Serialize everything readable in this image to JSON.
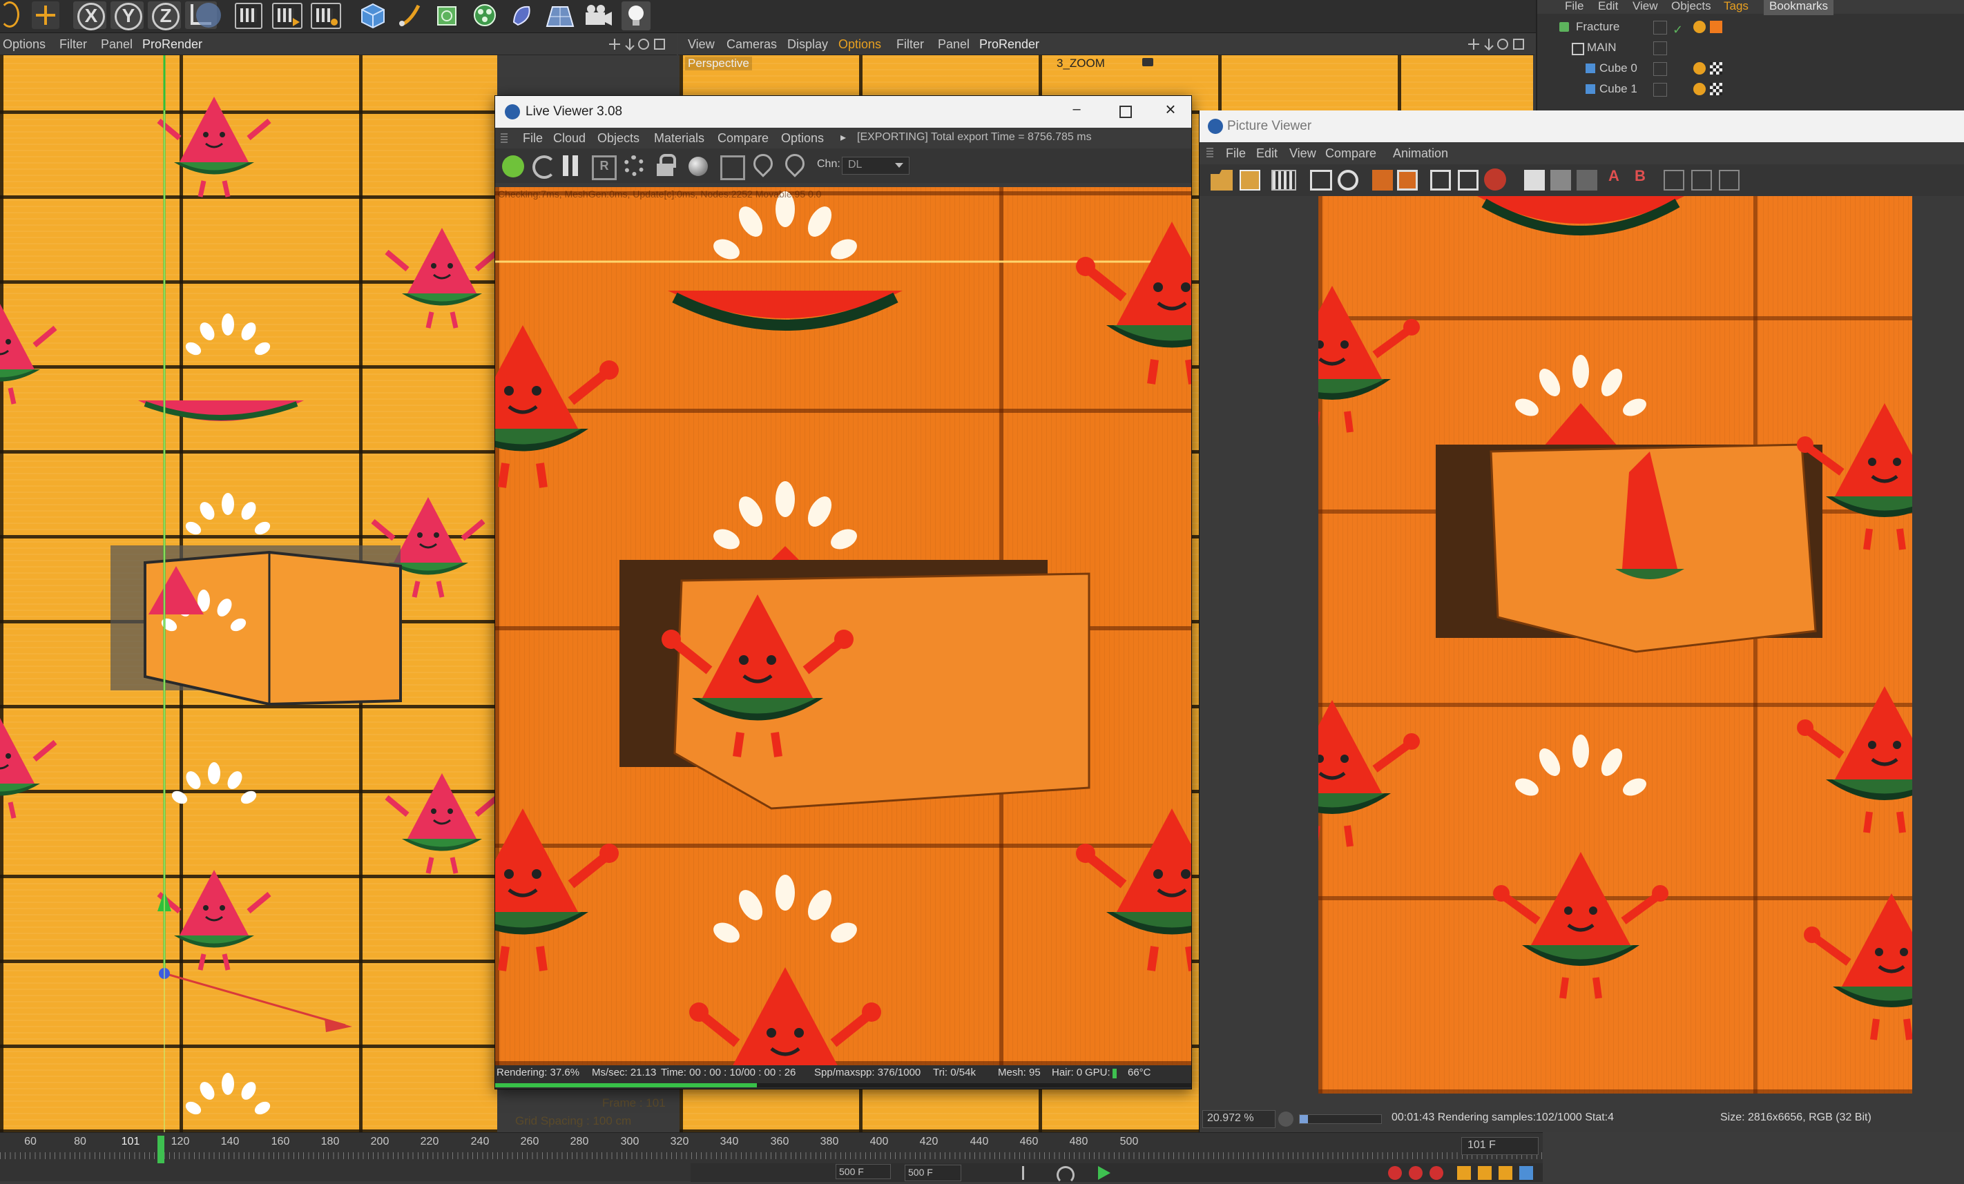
{
  "top_toolbar": {
    "axis_buttons": [
      "X",
      "Y",
      "Z"
    ]
  },
  "left_viewport": {
    "menu": [
      "Options",
      "Filter",
      "Panel",
      "ProRender"
    ],
    "frame_label": "Frame : 101",
    "grid_label": "Grid Spacing : 100 cm"
  },
  "perspective_viewport": {
    "menu": [
      "View",
      "Cameras",
      "Display",
      "Options",
      "Filter",
      "Panel",
      "ProRender"
    ],
    "label": "Perspective",
    "camera": "3_ZOOM"
  },
  "live_viewer": {
    "title": "Live Viewer 3.08",
    "menu": [
      "File",
      "Cloud",
      "Objects",
      "Materials",
      "Compare",
      "Options"
    ],
    "export_status": "[EXPORTING] Total export Time = 8756.785 ms",
    "channel_label": "Chn:",
    "channel_value": "DL",
    "overlay_text": "Checking:7ms, MeshGen:0ms, Update[c]:0ms, Nodes:2252 Movable:95  0.0",
    "status": {
      "rendering": "Rendering: 37.6%",
      "mssec": "Ms/sec: 21.13",
      "time": "Time: 00 : 00 : 10/00 : 00 : 26",
      "spp": "Spp/maxspp: 376/1000",
      "tri": "Tri: 0/54k",
      "mesh": "Mesh: 95",
      "hair": "Hair: 0",
      "gpu": "GPU:",
      "temp": "66°C"
    },
    "progress": 0.376
  },
  "picture_viewer": {
    "title": "Picture Viewer",
    "menu": [
      "File",
      "Edit",
      "View",
      "Compare",
      "Animation"
    ],
    "zoom": "20.972 %",
    "render_status": "00:01:43 Rendering samples:102/1000 Stat:4",
    "size_info": "Size: 2816x6656, RGB (32 Bit)"
  },
  "object_manager": {
    "menu": [
      "File",
      "Edit",
      "View",
      "Objects",
      "Tags",
      "Bookmarks"
    ],
    "objects": [
      "Fracture",
      "MAIN",
      "Cube 0",
      "Cube 1"
    ]
  },
  "timeline": {
    "ticks": [
      "60",
      "80",
      "101",
      "120",
      "140",
      "160",
      "180",
      "200",
      "220",
      "240",
      "260",
      "280",
      "300",
      "320",
      "340",
      "360",
      "380",
      "400",
      "420",
      "440",
      "460",
      "480",
      "500"
    ],
    "current_frame": "101 F",
    "start_field": "500 F",
    "end_field": "500 F"
  },
  "colors": {
    "accent_orange": "#e8a020",
    "menu_bg": "#333333",
    "active_tab": "#5a5a5a"
  }
}
